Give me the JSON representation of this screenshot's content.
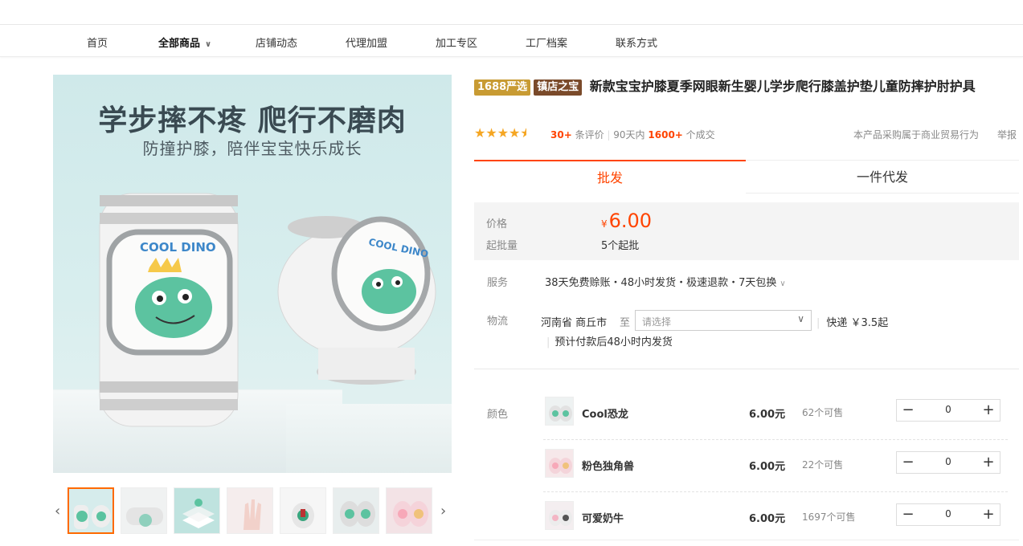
{
  "nav": {
    "items": [
      {
        "label": "首页"
      },
      {
        "label": "全部商品",
        "has_dropdown": true,
        "active": true
      },
      {
        "label": "店铺动态"
      },
      {
        "label": "代理加盟"
      },
      {
        "label": "加工专区"
      },
      {
        "label": "工厂档案"
      },
      {
        "label": "联系方式"
      }
    ]
  },
  "gallery": {
    "headline": "学步摔不疼 爬行不磨肉",
    "subheadline": "防撞护膝，陪伴宝宝快乐成长",
    "badge_text": "COOL DINO",
    "prev_icon": "chevron-left-icon",
    "next_icon": "chevron-right-icon",
    "thumbnail_count": 7,
    "selected_thumbnail": 1
  },
  "product": {
    "tag_1688": "1688严选",
    "tag_shop": "镇店之宝",
    "title": "新款宝宝护膝夏季网眼新生婴儿学步爬行膝盖护垫儿童防摔护肘护具",
    "rating_stars": 4.5,
    "review_count": "30+",
    "review_label": "条评价",
    "sales_period": "90天内",
    "sales_count": "1600+",
    "sales_label": "个成交",
    "business_note": "本产品采购属于商业贸易行为",
    "report_label": "举报"
  },
  "tabs": [
    {
      "label": "批发",
      "active": true
    },
    {
      "label": "一件代发",
      "active": false
    }
  ],
  "pricing": {
    "price_label": "价格",
    "currency": "¥",
    "price": "6.00",
    "moq_label": "起批量",
    "moq": "5个起批"
  },
  "service": {
    "label": "服务",
    "text": "38天免费赊账・48小时发货・极速退款・7天包换"
  },
  "logistics": {
    "label": "物流",
    "origin": "河南省 商丘市",
    "to_label": "至",
    "destination_placeholder": "请选择",
    "shipping": "快递 ￥3.5起",
    "eta": "预计付款后48小时内发货"
  },
  "skus": {
    "label": "颜色",
    "items": [
      {
        "name": "Cool恐龙",
        "price": "6.00元",
        "stock": "62个可售",
        "qty": "0"
      },
      {
        "name": "粉色独角兽",
        "price": "6.00元",
        "stock": "22个可售",
        "qty": "0"
      },
      {
        "name": "可爱奶牛",
        "price": "6.00元",
        "stock": "1697个可售",
        "qty": "0"
      }
    ]
  },
  "colors": {
    "accent": "#ff4400",
    "gold_tag": "#c89b33",
    "brown_tag": "#7a4a2a",
    "star": "#f5a623",
    "image_bg": "#d3ebeb",
    "dino_green": "#5cc3a0"
  }
}
